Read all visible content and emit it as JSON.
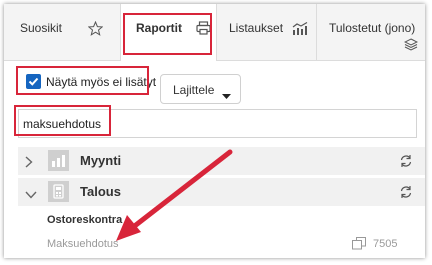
{
  "tabs": [
    {
      "label": "Suosikit",
      "icon": "star-icon"
    },
    {
      "label": "Raportit",
      "icon": "printer-icon",
      "active": true
    },
    {
      "label": "Listaukset",
      "icon": "chart-icon"
    },
    {
      "label": "Tulostetut (jono)",
      "icon": "layers-icon"
    }
  ],
  "toolbar": {
    "show_extra_label": "Näytä myös ei lisätyt",
    "show_extra_checked": true,
    "sort_label": "Lajittele"
  },
  "search": {
    "value": "maksuehdotus"
  },
  "groups": [
    {
      "label": "Myynti",
      "expanded": false,
      "icon": "bar-chart-icon"
    },
    {
      "label": "Talous",
      "expanded": true,
      "icon": "calculator-icon"
    }
  ],
  "section": {
    "title": "Ostoreskontra",
    "items": [
      {
        "name": "Maksuehdotus",
        "number": "7505"
      }
    ]
  },
  "colors": {
    "annotation_red": "#d8253a",
    "checkbox_blue": "#1565c0"
  }
}
